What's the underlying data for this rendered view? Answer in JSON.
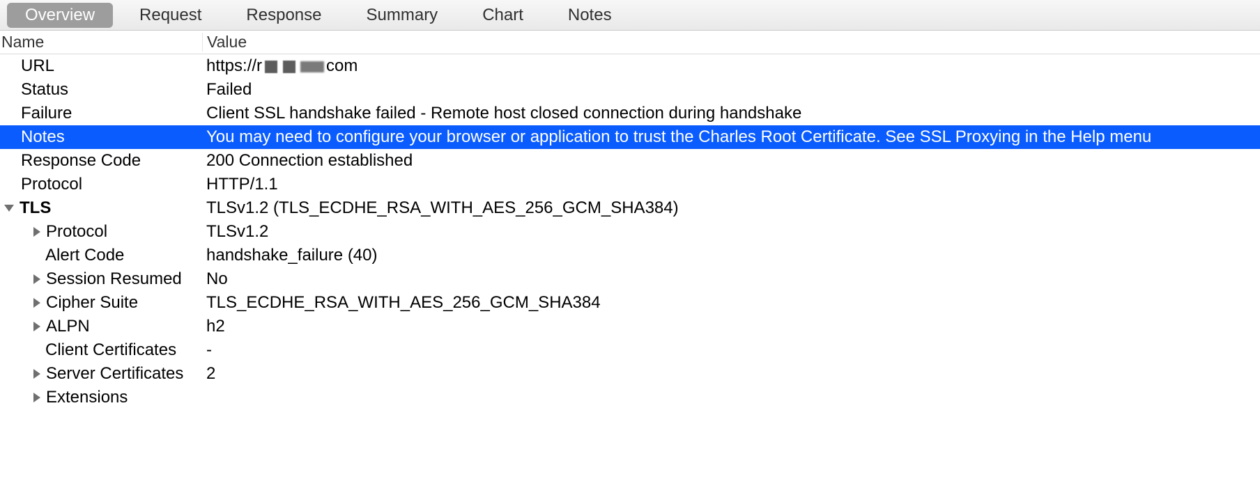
{
  "tabs": [
    "Overview",
    "Request",
    "Response",
    "Summary",
    "Chart",
    "Notes"
  ],
  "activeTab": "Overview",
  "headers": {
    "name": "Name",
    "value": "Value"
  },
  "rows": {
    "url": {
      "label": "URL",
      "value_prefix": "https://r",
      "value_suffix": "com"
    },
    "status": {
      "label": "Status",
      "value": "Failed"
    },
    "failure": {
      "label": "Failure",
      "value": "Client SSL handshake failed - Remote host closed connection during handshake"
    },
    "notes": {
      "label": "Notes",
      "value": "You may need to configure your browser or application to trust the Charles Root Certificate. See SSL Proxying in the Help menu"
    },
    "respcode": {
      "label": "Response Code",
      "value": "200 Connection established"
    },
    "protocol": {
      "label": "Protocol",
      "value": "HTTP/1.1"
    },
    "tls": {
      "label": "TLS",
      "value": "TLSv1.2 (TLS_ECDHE_RSA_WITH_AES_256_GCM_SHA384)"
    },
    "tls_proto": {
      "label": "Protocol",
      "value": "TLSv1.2"
    },
    "alert": {
      "label": "Alert Code",
      "value": "handshake_failure (40)"
    },
    "session": {
      "label": "Session Resumed",
      "value": "No"
    },
    "cipher": {
      "label": "Cipher Suite",
      "value": "TLS_ECDHE_RSA_WITH_AES_256_GCM_SHA384"
    },
    "alpn": {
      "label": "ALPN",
      "value": "h2"
    },
    "clientcert": {
      "label": "Client Certificates",
      "value": "-"
    },
    "servercert": {
      "label": "Server Certificates",
      "value": "2"
    },
    "ext": {
      "label": "Extensions",
      "value": ""
    }
  }
}
